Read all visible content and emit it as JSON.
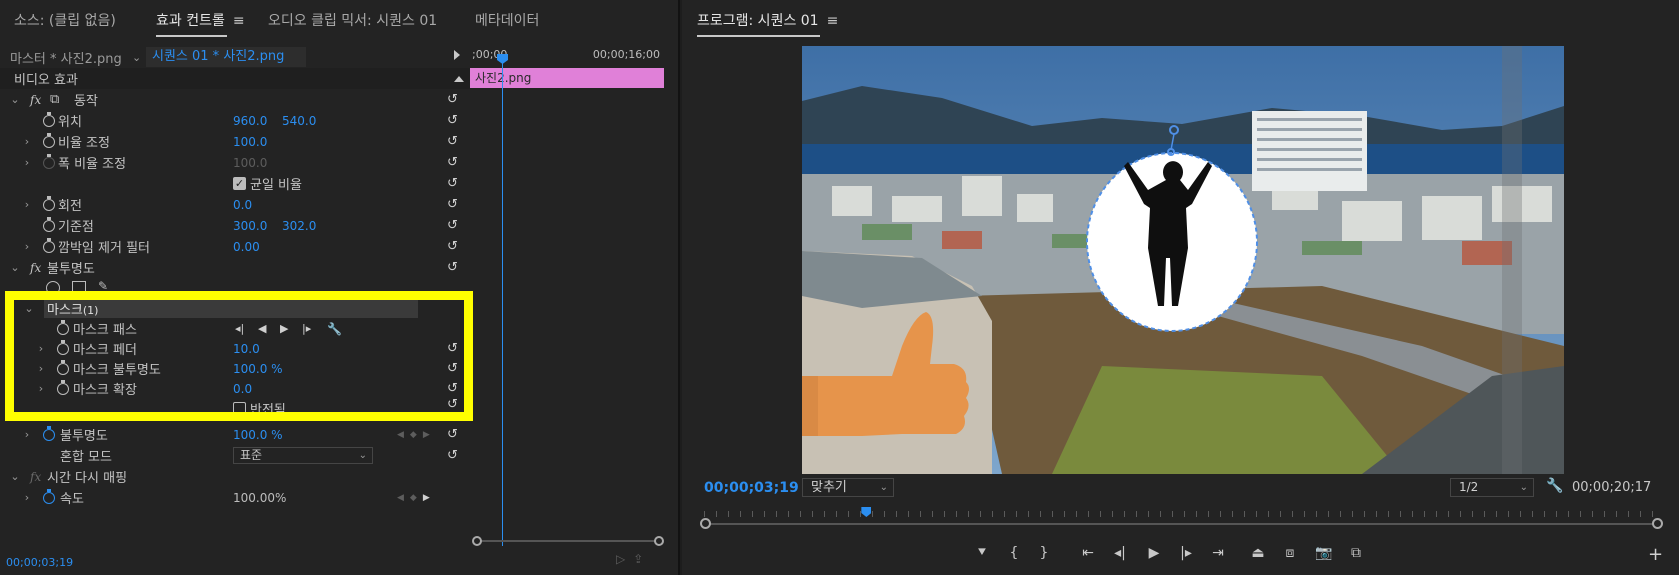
{
  "effect_controls_panel": {
    "tabs": [
      {
        "label": "소스: (클립 없음)",
        "active": false
      },
      {
        "label": "효과 컨트롤",
        "active": true
      },
      {
        "label": "오디오 클립 믹서: 시퀀스 01",
        "active": false
      },
      {
        "label": "메타데이터",
        "active": false
      }
    ],
    "menu_icon": "≡",
    "master_clip": "마스터 * 사진2.png",
    "sequence_clip": "시퀀스 01 * 사진2.png",
    "video_effects_label": "비디오 효과",
    "motion": {
      "label": "동작",
      "position": {
        "label": "위치",
        "x": "960.0",
        "y": "540.0"
      },
      "scale": {
        "label": "비율 조정",
        "value": "100.0"
      },
      "scale_width": {
        "label": "폭 비율 조정",
        "value": "100.0"
      },
      "uniform_scale": {
        "label": "균일 비율",
        "checked": true
      },
      "rotation": {
        "label": "회전",
        "value": "0.0"
      },
      "anchor": {
        "label": "기준점",
        "x": "300.0",
        "y": "302.0"
      },
      "anti_flicker": {
        "label": "깜박임 제거 필터",
        "value": "0.00"
      }
    },
    "opacity": {
      "label": "불투명도",
      "mask": {
        "label": "마스크",
        "count": "(1)",
        "mask_path": {
          "label": "마스크 패스"
        },
        "mask_feather": {
          "label": "마스크 페더",
          "value": "10.0"
        },
        "mask_opacity": {
          "label": "마스크 불투명도",
          "value": "100.0 %"
        },
        "mask_expansion": {
          "label": "마스크 확장",
          "value": "0.0"
        },
        "inverted": {
          "label": "반전됨"
        }
      },
      "opacity_value": {
        "label": "불투명도",
        "value": "100.0 %"
      },
      "blend_mode": {
        "label": "혼합 모드",
        "value": "표준"
      }
    },
    "time_remap": {
      "label": "시간 다시 매핑",
      "speed": {
        "label": "속도",
        "value": "100.00%"
      }
    },
    "mini_timeline": {
      "start_time": ";00;00",
      "end_time": "00;00;16;00",
      "clip_label": "사진2.png"
    },
    "current_time": "00;00;03;19"
  },
  "program_monitor": {
    "title": "프로그램: 시퀀스 01",
    "menu_icon": "≡",
    "current_time": "00;00;03;19",
    "zoom_fit": "맞추기",
    "resolution": "1/2",
    "duration": "00;00;20;17",
    "playhead_fraction": 0.17
  },
  "colors": {
    "accent_blue": "#2b8ef0",
    "highlight_yellow": "#ffff00",
    "clip_pink": "#e080d8",
    "panel_bg": "#232323"
  }
}
